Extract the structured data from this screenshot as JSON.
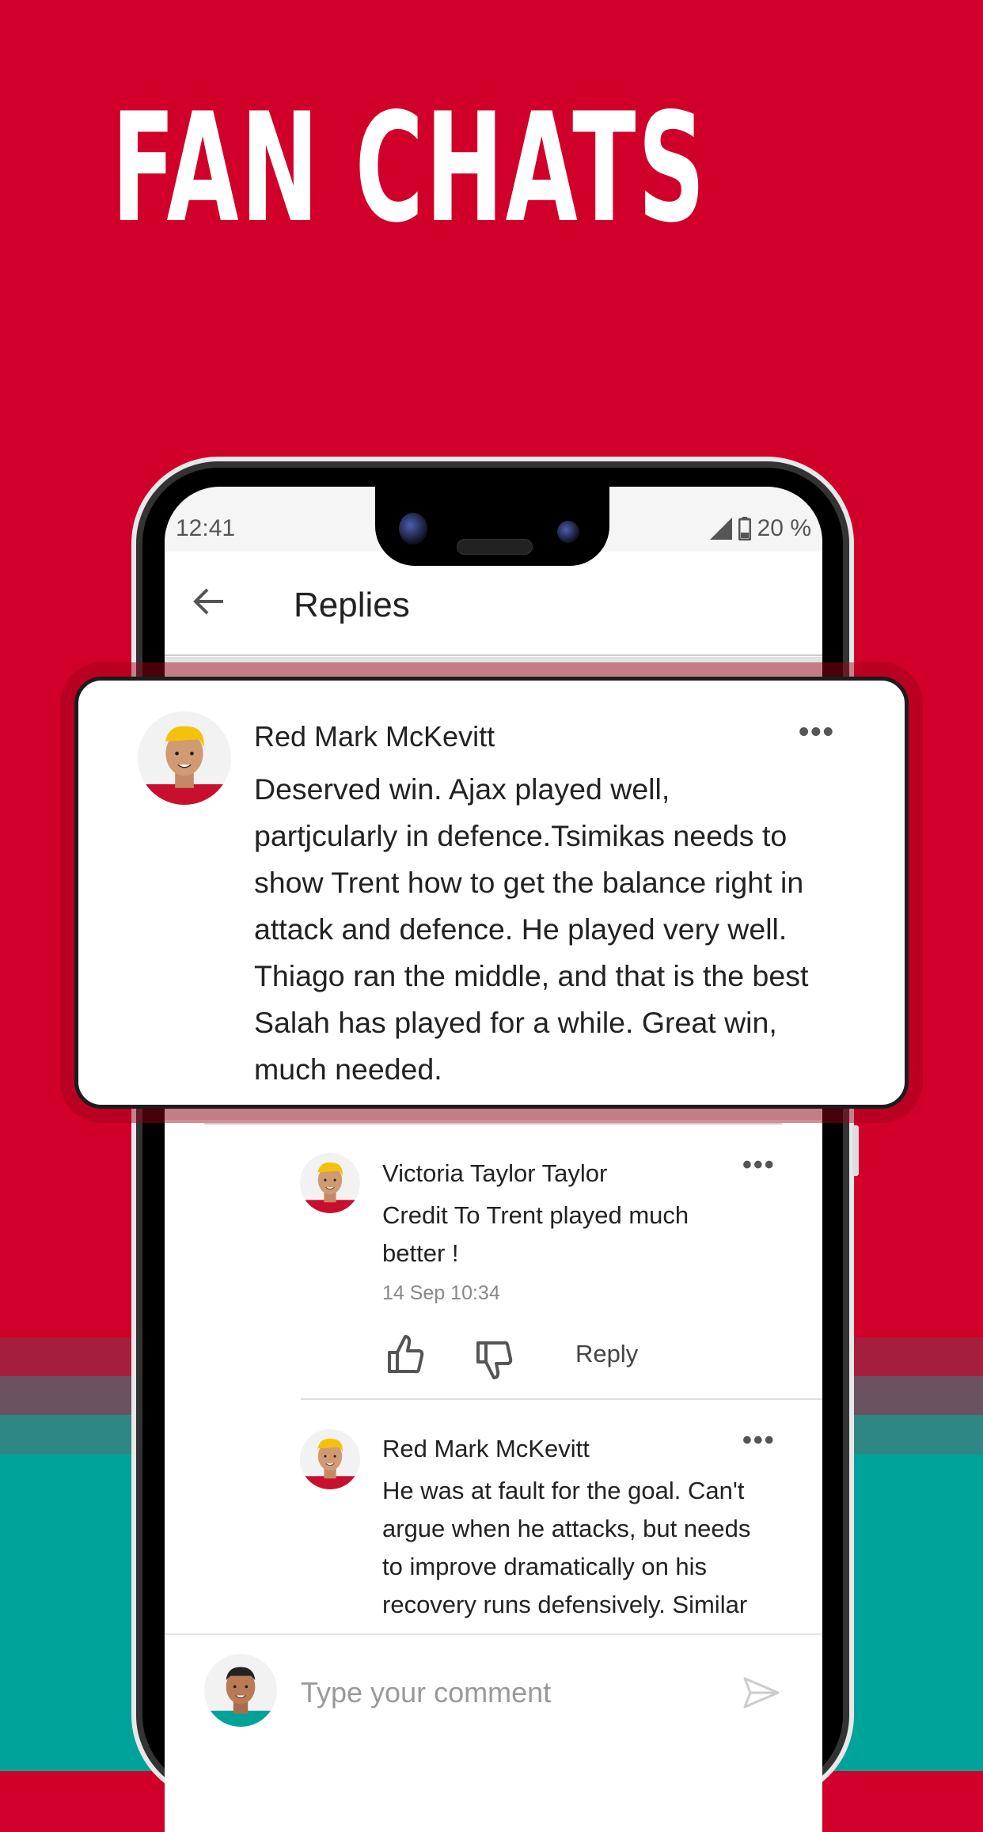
{
  "headline": "FAN CHATS",
  "colors": {
    "brand_red": "#d0002a",
    "teal": "#00a39a"
  },
  "status_bar": {
    "time": "12:41",
    "battery": "20 %",
    "icons": [
      "signal-icon",
      "battery-icon"
    ]
  },
  "header": {
    "title": "Replies",
    "back_icon": "arrow-left-icon"
  },
  "main_comment": {
    "author": "Red Mark McKevitt",
    "text": "Deserved win. Ajax played well, partjcularly in defence.Tsimikas needs to show Trent how to get the balance right in attack and defence. He played very well. Thiago ran the middle, and that is the best Salah has played for a while. Great win, much needed.",
    "lines": [
      "Deserved win. Ajax played well,",
      "partjcularly in defence.Tsimikas needs to",
      "show Trent how to get the balance right in",
      "attack and defence. He played very well.",
      "Thiago ran the middle, and that is the best",
      "Salah has played for a while. Great win,",
      "much needed."
    ]
  },
  "replies": [
    {
      "author": "Victoria Taylor Taylor",
      "lines": [
        "Credit To Trent played much",
        "better !"
      ],
      "date": "14 Sep 10:34",
      "reply_label": "Reply"
    },
    {
      "author": "Red Mark McKevitt",
      "lines": [
        "He was at fault for the goal. Can't",
        "argue when he attacks, but needs",
        "to improve dramatically on his",
        "recovery runs defensively. Similar"
      ]
    }
  ],
  "composer": {
    "placeholder": "Type your comment",
    "send_icon": "send-icon"
  }
}
